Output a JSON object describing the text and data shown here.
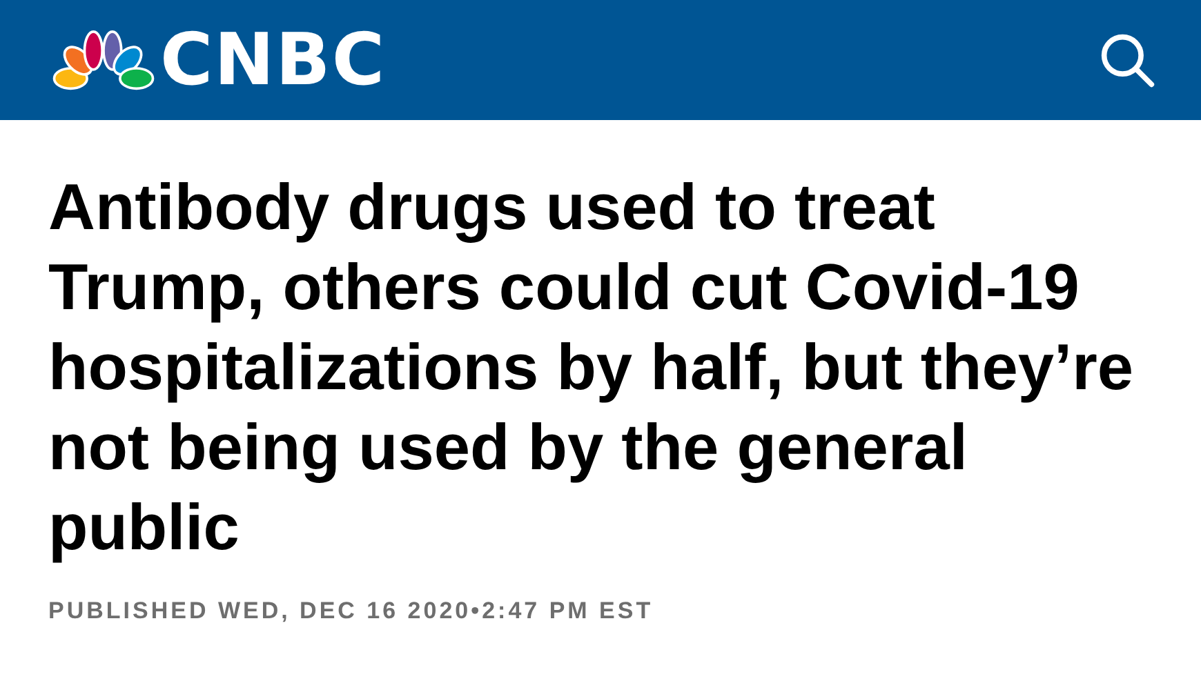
{
  "header": {
    "logo_text": "CNBC"
  },
  "headline": "Antibody drugs used to treat Trump, others could cut Covid-19 hospitalizations by half, but they’re not being used by the general public",
  "published": "PUBLISHED WED, DEC 16 2020•2:47 PM EST"
}
